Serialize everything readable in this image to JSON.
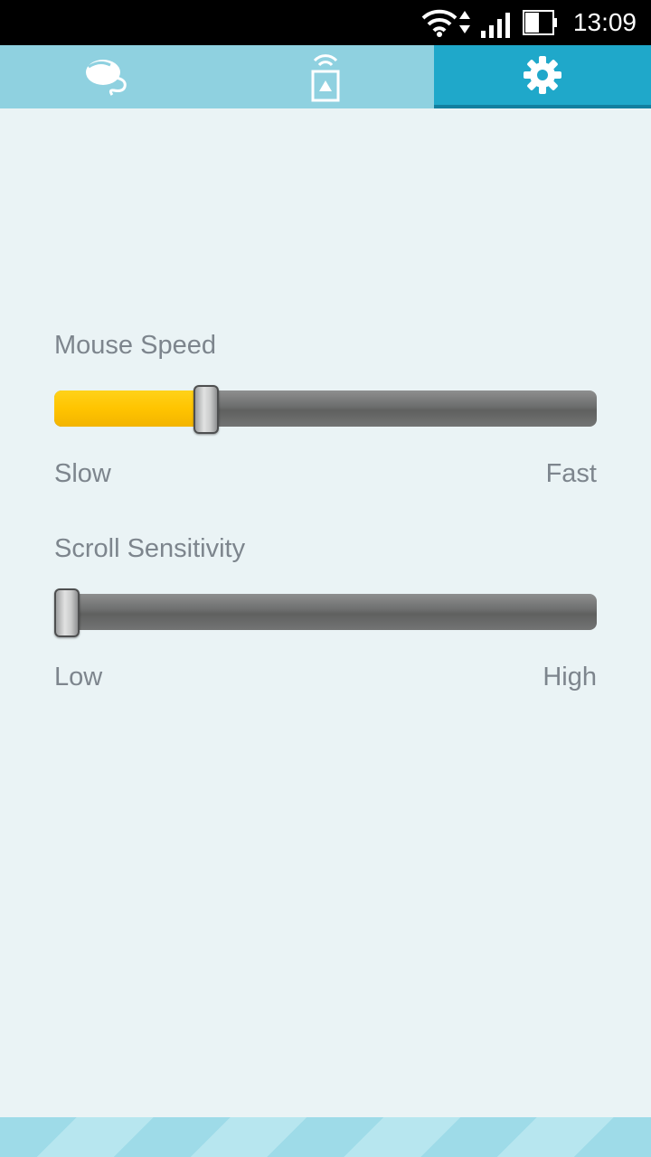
{
  "status_bar": {
    "time": "13:09",
    "icons": [
      "wifi-icon",
      "data-arrows-icon",
      "signal-icon",
      "battery-icon"
    ]
  },
  "tabs": [
    {
      "name": "mouse",
      "icon": "mouse-icon",
      "active": false
    },
    {
      "name": "remote",
      "icon": "remote-icon",
      "active": false
    },
    {
      "name": "settings",
      "icon": "gear-icon",
      "active": true
    }
  ],
  "settings": {
    "mouse_speed": {
      "label": "Mouse Speed",
      "min_label": "Slow",
      "max_label": "Fast",
      "value_fraction": 0.27
    },
    "scroll_sensitivity": {
      "label": "Scroll Sensitivity",
      "min_label": "Low",
      "max_label": "High",
      "value_fraction": 0.0
    }
  },
  "colors": {
    "tab_bar": "#8fd1e0",
    "tab_active": "#1fa8ca",
    "slider_fill": "#ffc400",
    "background": "#eaf3f5",
    "text": "#7d858d"
  }
}
